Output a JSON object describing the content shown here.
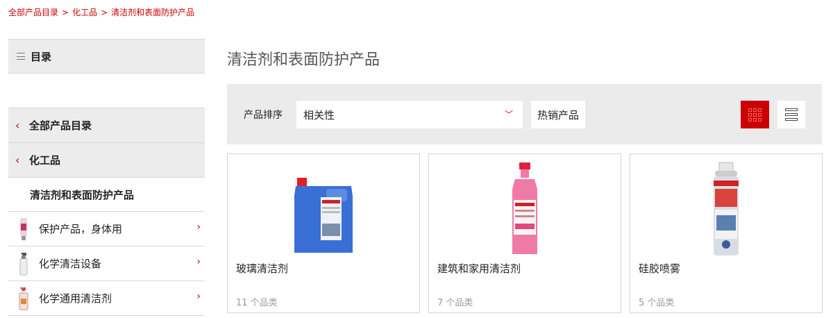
{
  "breadcrumb": [
    "全部产品目录",
    "化工品",
    "清洁剂和表面防护产品"
  ],
  "sidebar": {
    "header_label": "目录",
    "parents": [
      {
        "label": "全部产品目录"
      },
      {
        "label": "化工品"
      }
    ],
    "current": "清洁剂和表面防护产品",
    "children": [
      {
        "label": "保护产品，身体用",
        "icon": "tube-icon"
      },
      {
        "label": "化学清洁设备",
        "icon": "spray-bottle-icon"
      },
      {
        "label": "化学通用清洁剂",
        "icon": "spray-bottle-icon"
      }
    ]
  },
  "main": {
    "title": "清洁剂和表面防护产品",
    "toolbar": {
      "sort_label": "产品排序",
      "sort_value": "相关性",
      "hot_label": "热销产品"
    },
    "products": [
      {
        "name": "玻璃清洁剂",
        "count": "11 个品类",
        "image": "blue-canister-image"
      },
      {
        "name": "建筑和家用清洁剂",
        "count": "7 个品类",
        "image": "pink-bottle-image"
      },
      {
        "name": "硅胶喷雾",
        "count": "5 个品类",
        "image": "spray-can-image"
      }
    ]
  },
  "colors": {
    "accent": "#cc0000",
    "panel": "#ebebeb"
  }
}
